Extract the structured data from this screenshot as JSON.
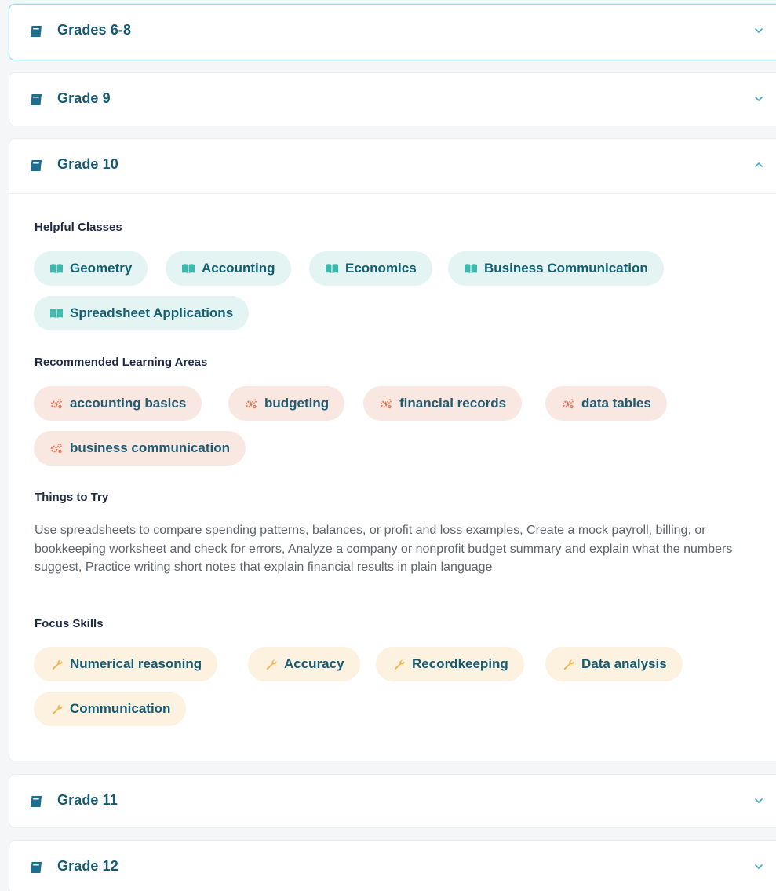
{
  "grades": [
    {
      "title": "Grades 6-8",
      "expanded": false,
      "active": true
    },
    {
      "title": "Grade 9",
      "expanded": false
    },
    {
      "title": "Grade 10",
      "expanded": true
    },
    {
      "title": "Grade 11",
      "expanded": false
    },
    {
      "title": "Grade 12",
      "expanded": false
    }
  ],
  "grade10": {
    "helpful_classes": {
      "title": "Helpful Classes",
      "items": [
        "Geometry",
        "Accounting",
        "Economics",
        "Business Communication",
        "Spreadsheet Applications"
      ]
    },
    "learning_areas": {
      "title": "Recommended Learning Areas",
      "items": [
        "accounting basics",
        "budgeting",
        "financial records",
        "data tables",
        "business communication"
      ]
    },
    "things_to_try": {
      "title": "Things to Try",
      "text": "Use spreadsheets to compare spending patterns, balances, or profit and loss examples, Create a mock payroll, billing, or bookkeeping worksheet and check for errors, Analyze a company or nonprofit budget summary and explain what the numbers suggest, Practice writing short notes that explain financial results in plain language"
    },
    "focus_skills": {
      "title": "Focus Skills",
      "items": [
        "Numerical reasoning",
        "Accuracy",
        "Recordkeeping",
        "Data analysis",
        "Communication"
      ]
    }
  },
  "colors": {
    "title": "#155a73",
    "class_pill_bg": "#e4f4f2",
    "area_pill_bg": "#f9e8e2",
    "skill_pill_bg": "#fdf1df",
    "class_icon": "#3fb9ad",
    "area_icon": "#ef7a58",
    "skill_icon": "#f0b24a",
    "book_icon": "#1c6f90"
  },
  "icons": {
    "grade": "book-icon",
    "class": "open-book-icon",
    "area": "gears-icon",
    "skill": "wrench-icon",
    "collapsed": "chevron-down-icon",
    "expanded": "chevron-up-icon"
  }
}
